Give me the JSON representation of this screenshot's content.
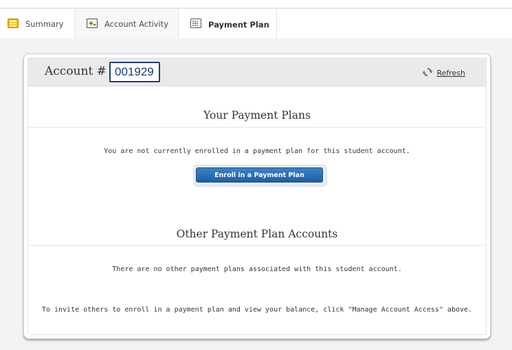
{
  "tabs": [
    {
      "label": "Summary",
      "icon": "summary-icon",
      "active": false
    },
    {
      "label": "Account Activity",
      "icon": "account-activity-icon",
      "active": false
    },
    {
      "label": "Payment Plan",
      "icon": "payment-plan-icon",
      "active": true
    }
  ],
  "account": {
    "label": "Account #",
    "number": "001929",
    "refresh_label": "Refresh"
  },
  "your_plans": {
    "title": "Your Payment Plans",
    "message": "You are not currently enrolled in a payment plan for this student account.",
    "enroll_button": "Enroll in a Payment Plan"
  },
  "other_plans": {
    "title": "Other Payment Plan Accounts",
    "message": "There are no other payment plans associated with this student account.",
    "invite_message": "To invite others to enroll in a payment plan and view your balance, click \"Manage Account Access\" above."
  },
  "colors": {
    "button_top": "#3d82c4",
    "button_bottom": "#1e5ea6",
    "account_box_border": "#223e6b",
    "account_number": "#1c3c7a"
  }
}
